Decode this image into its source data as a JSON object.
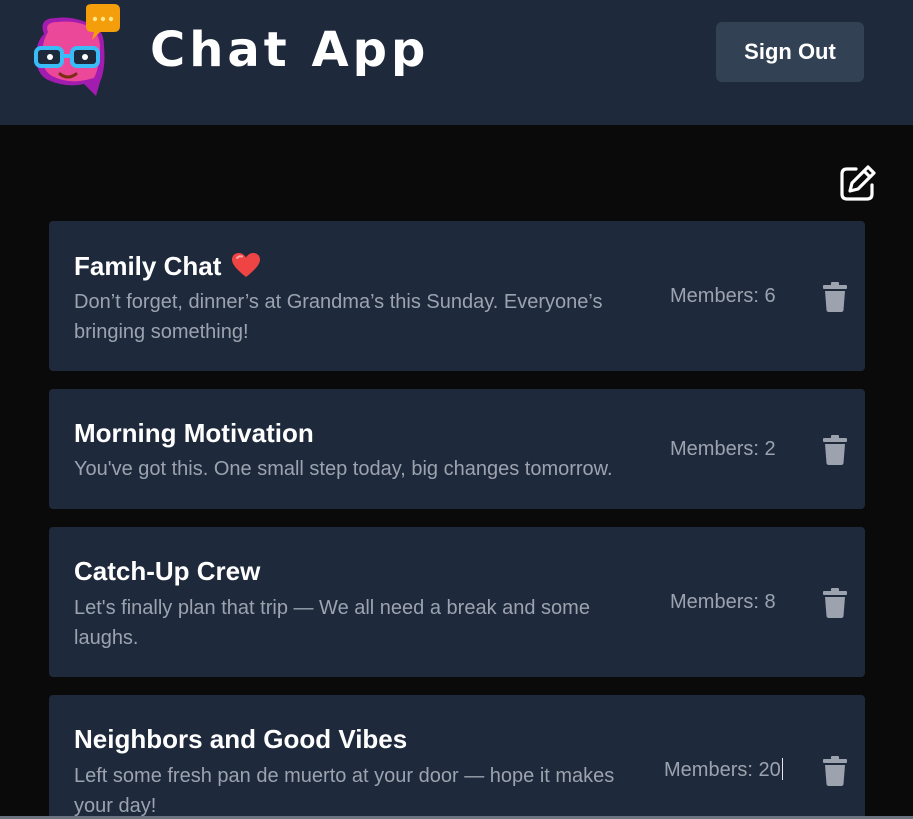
{
  "header": {
    "app_title": "Chat App",
    "sign_out_label": "Sign Out",
    "logo_icon": "chat-avatar-logo-icon"
  },
  "toolbar": {
    "compose_icon": "edit-square-icon"
  },
  "colors": {
    "header_bg": "#1e293b",
    "page_bg": "#0a0a0a",
    "card_bg": "#1e293b",
    "button_bg": "#334155",
    "muted_text": "#9ca3af",
    "heart": "#ef4444"
  },
  "chats": [
    {
      "title": "Family Chat",
      "emoji": "heart",
      "preview": "Don’t forget, dinner’s at Grandma’s this Sunday. Everyone’s bringing something!",
      "members": "Members: 6"
    },
    {
      "title": "Morning Motivation",
      "preview": "You've got this. One small step today, big changes tomorrow.",
      "members": "Members: 2"
    },
    {
      "title": "Catch-Up Crew",
      "preview": "Let's finally plan that trip — We all need a break and some laughs.",
      "members": "Members: 8"
    },
    {
      "title": "Neighbors and Good Vibes",
      "preview": "Left some fresh pan de muerto at your door — hope it makes your day!",
      "members": "Members: 20"
    }
  ]
}
